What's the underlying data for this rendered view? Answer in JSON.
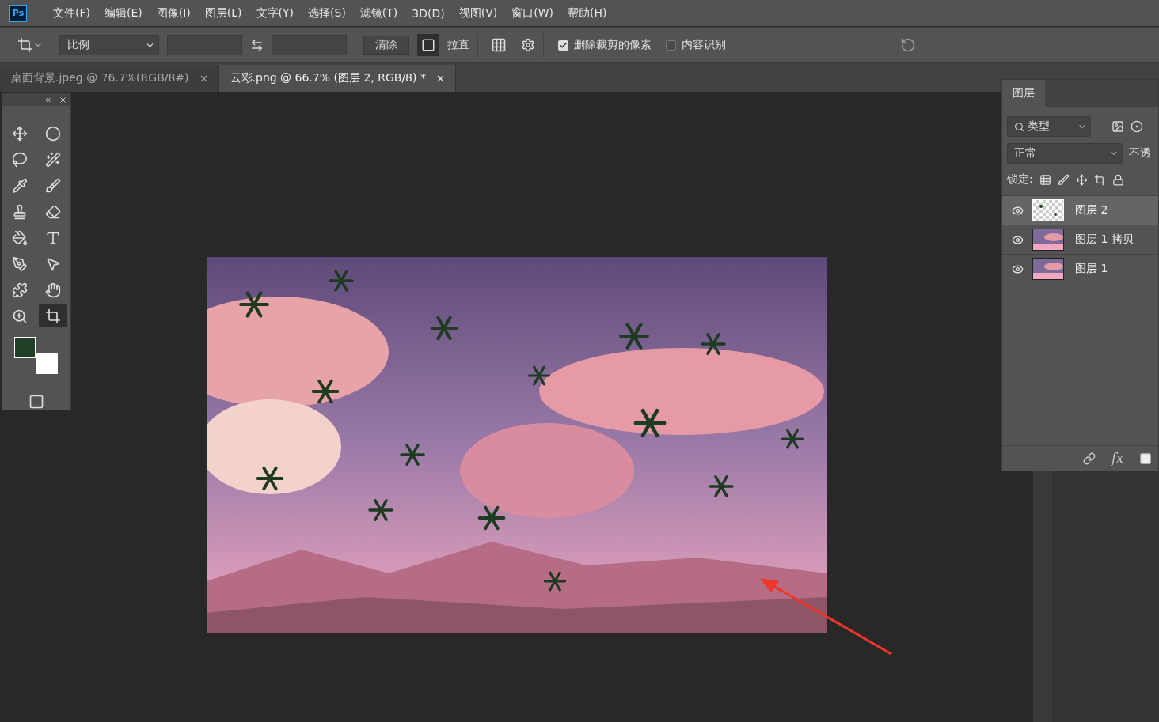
{
  "app_logo": "Ps",
  "menu": [
    "文件(F)",
    "编辑(E)",
    "图像(I)",
    "图层(L)",
    "文字(Y)",
    "选择(S)",
    "滤镜(T)",
    "3D(D)",
    "视图(V)",
    "窗口(W)",
    "帮助(H)"
  ],
  "options_bar": {
    "ratio": "比例",
    "clear": "清除",
    "straighten": "拉直",
    "options": [
      {
        "label": "删除裁剪的像素",
        "checked": true
      },
      {
        "label": "内容识别",
        "checked": false
      }
    ]
  },
  "tabs": [
    {
      "label": "桌面背景.jpeg @ 76.7%(RGB/8#)",
      "selected": false
    },
    {
      "label": "云彩.png @ 66.7% (图层 2, RGB/8) *",
      "selected": true
    }
  ],
  "tools": [
    {
      "kind": "move",
      "selected": false
    },
    {
      "kind": "marquee",
      "selected": false
    },
    {
      "kind": "lasso",
      "selected": false
    },
    {
      "kind": "wand",
      "selected": false
    },
    {
      "kind": "eyedropper",
      "selected": false
    },
    {
      "kind": "brush",
      "selected": false
    },
    {
      "kind": "stamp",
      "selected": false
    },
    {
      "kind": "eraser",
      "selected": false
    },
    {
      "kind": "bucket",
      "selected": false
    },
    {
      "kind": "type",
      "selected": false
    },
    {
      "kind": "pen",
      "selected": false
    },
    {
      "kind": "select",
      "selected": false
    },
    {
      "kind": "shape",
      "selected": false
    },
    {
      "kind": "hand",
      "selected": false
    },
    {
      "kind": "zoom",
      "selected": false
    },
    {
      "kind": "crop",
      "selected": true
    }
  ],
  "swatches": [
    {
      "color": "#213f26"
    },
    {
      "color": "#ffffff"
    }
  ],
  "layers_panel": {
    "tab": "图层",
    "filter": "类型",
    "blend_mode": "正常",
    "opacity_label": "不透",
    "lock_label": "锁定:",
    "effects_label": "fx",
    "layers": [
      {
        "name": "图层 2",
        "kind": "transparent",
        "visible": true,
        "selected": true
      },
      {
        "name": "图层 1 拷贝",
        "visible": true,
        "selected": false
      },
      {
        "name": "图层 1",
        "visible": true,
        "selected": false
      }
    ]
  }
}
